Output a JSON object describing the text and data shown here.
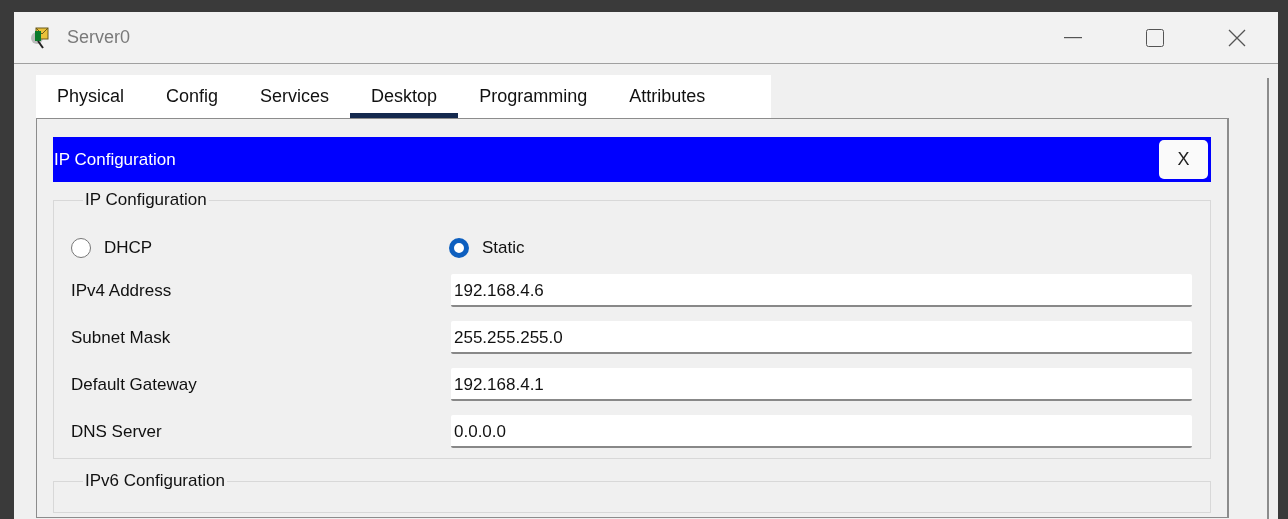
{
  "window": {
    "title": "Server0"
  },
  "tabs": [
    {
      "label": "Physical",
      "selected": false
    },
    {
      "label": "Config",
      "selected": false
    },
    {
      "label": "Services",
      "selected": false
    },
    {
      "label": "Desktop",
      "selected": true
    },
    {
      "label": "Programming",
      "selected": false
    },
    {
      "label": "Attributes",
      "selected": false
    }
  ],
  "panel": {
    "title": "IP Configuration",
    "close_label": "X"
  },
  "ip_configuration": {
    "title": "IP Configuration",
    "modes": [
      {
        "label": "DHCP",
        "selected": false
      },
      {
        "label": "Static",
        "selected": true
      }
    ],
    "fields": [
      {
        "label": "IPv4 Address",
        "value": "192.168.4.6"
      },
      {
        "label": "Subnet Mask",
        "value": "255.255.255.0"
      },
      {
        "label": "Default Gateway",
        "value": "192.168.4.1"
      },
      {
        "label": "DNS Server",
        "value": "0.0.0.0"
      }
    ]
  },
  "ipv6_configuration": {
    "title": "IPv6 Configuration"
  }
}
